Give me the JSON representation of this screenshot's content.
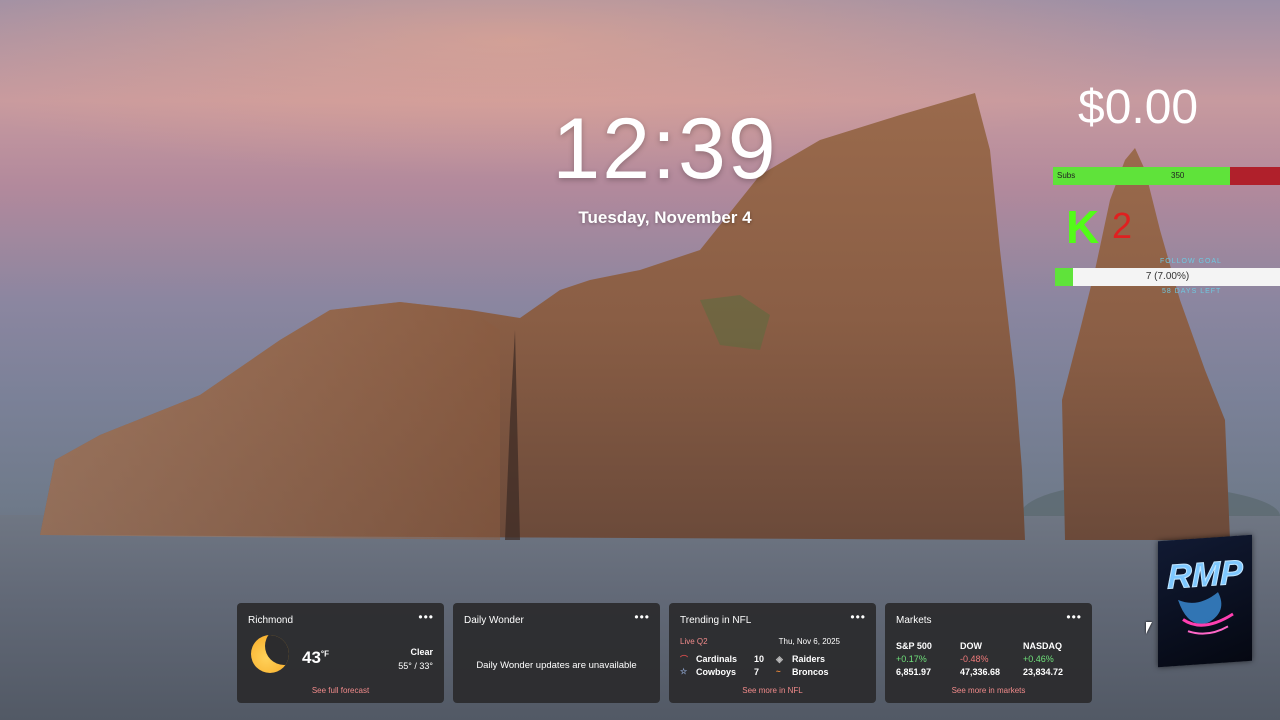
{
  "lockscreen": {
    "time": "12:39",
    "date": "Tuesday, November 4"
  },
  "stream_overlay": {
    "amount": "$0.00",
    "subs_label": "Subs",
    "subs_count": "350",
    "subs_fill_fraction": 0.78,
    "kick_letter": "K",
    "kick_count": "2",
    "follow_goal_label": "FOLLOW GOAL",
    "follow_text": "7 (7.00%)",
    "follow_fraction": 0.07,
    "follow_sub_label": "58 DAYS LEFT",
    "logo_text": "RMP"
  },
  "widgets": {
    "weather": {
      "title": "Richmond",
      "temp": "43",
      "unit": "°F",
      "condition": "Clear",
      "range": "55° / 33°",
      "link": "See full forecast",
      "icon": "moon-icon"
    },
    "daily_wonder": {
      "title": "Daily Wonder",
      "message": "Daily Wonder updates are unavailable"
    },
    "nfl": {
      "title": "Trending in NFL",
      "status": "Live Q2",
      "date": "Thu, Nov  6, 2025",
      "games": [
        {
          "team1": "Cardinals",
          "score1": "10",
          "team2": "Raiders"
        },
        {
          "team1": "Cowboys",
          "score1": "7",
          "team2": "Broncos"
        }
      ],
      "link": "See more in NFL"
    },
    "markets": {
      "title": "Markets",
      "items": [
        {
          "name": "S&P 500",
          "change": "+0.17%",
          "value": "6,851.97"
        },
        {
          "name": "DOW",
          "change": "-0.48%",
          "value": "47,336.68"
        },
        {
          "name": "NASDAQ",
          "change": "+0.46%",
          "value": "23,834.72"
        }
      ],
      "link": "See more in markets"
    },
    "more_label": "•••"
  }
}
